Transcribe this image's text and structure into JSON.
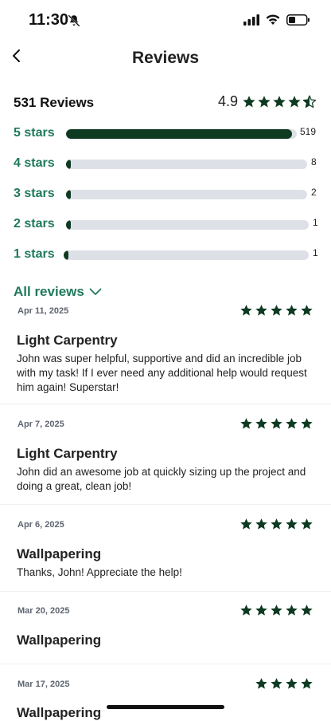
{
  "status_bar": {
    "time": "11:30"
  },
  "header": {
    "title": "Reviews"
  },
  "summary": {
    "count_label": "531 Reviews",
    "rating": "4.9",
    "rating_stars": 4.5,
    "breakdown": [
      {
        "label": "5 stars",
        "count": "519",
        "fraction": 0.98
      },
      {
        "label": "4 stars",
        "count": "8",
        "fraction": 0.02
      },
      {
        "label": "3 stars",
        "count": "2",
        "fraction": 0.02
      },
      {
        "label": "2 stars",
        "count": "1",
        "fraction": 0.02
      },
      {
        "label": "1 stars",
        "count": "1",
        "fraction": 0.02
      }
    ]
  },
  "filter": {
    "label": "All reviews"
  },
  "reviews": [
    {
      "date": "Apr 11, 2025",
      "stars": 5,
      "title": "Light Carpentry",
      "body": "John was super helpful, supportive and did an incredible job with my task! If I ever need any additional help would request him again! Superstar!"
    },
    {
      "date": "Apr 7, 2025",
      "stars": 5,
      "title": "Light Carpentry",
      "body": "John did an awesome job at quickly sizing up the project and doing a great, clean job!"
    },
    {
      "date": "Apr 6, 2025",
      "stars": 5,
      "title": "Wallpapering",
      "body": "Thanks, John! Appreciate the help!"
    },
    {
      "date": "Mar 20, 2025",
      "stars": 5,
      "title": "Wallpapering",
      "body": ""
    },
    {
      "date": "Mar 17, 2025",
      "stars": 4,
      "title": "Wallpapering",
      "body": ""
    }
  ],
  "colors": {
    "accent": "#1f7a5a",
    "star": "#0e3a22",
    "track": "#dde1e7"
  }
}
